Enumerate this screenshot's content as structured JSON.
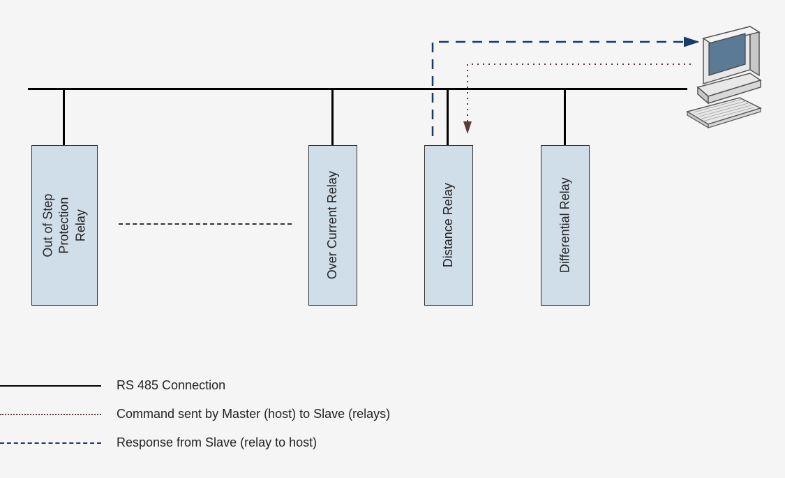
{
  "diagram": {
    "relays": {
      "out_of_step": "Out of Step\nProtection Relay",
      "over_current": "Over Current Relay",
      "distance": "Distance Relay",
      "differential": "Differential Relay"
    },
    "legend": {
      "rs485": "RS 485 Connection",
      "command": "Command sent by Master (host) to Slave (relays)",
      "response": "Response from Slave (relay to host)"
    },
    "icons": {
      "computer": "computer-with-keyboard"
    }
  }
}
